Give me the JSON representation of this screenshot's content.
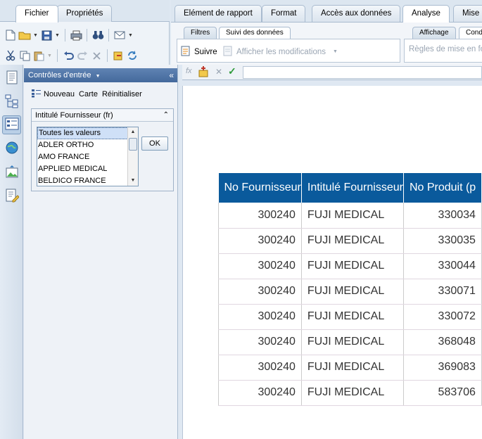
{
  "left_tabs": {
    "fichier": "Fichier",
    "proprietes": "Propriétés"
  },
  "ribbon": {
    "tabs": [
      "Elément de rapport",
      "Format",
      "Accès aux données",
      "Analyse",
      "Mise e"
    ],
    "active_tab": "Analyse",
    "subtabs_left": [
      "Filtres",
      "Suivi des données"
    ],
    "subtabs_right": [
      "Affichage",
      "Cond"
    ],
    "suivre_label": "Suivre",
    "afficher_label": "Afficher les modifications",
    "regles_label": "Règles de mise en fo"
  },
  "panel": {
    "title": "Contrôles d'entrée",
    "collapse_glyph": "«",
    "actions": {
      "nouveau": "Nouveau",
      "carte": "Carte",
      "reinitialiser": "Réinitialiser"
    },
    "control": {
      "title": "Intitulé Fournisseur (fr)",
      "items": [
        "Toutes les valeurs",
        "ADLER ORTHO",
        "AMO FRANCE",
        "APPLIED MEDICAL",
        "BELDICO FRANCE"
      ],
      "selected_index": 0,
      "ok_label": "OK"
    }
  },
  "formula_bar": {
    "fx": "fx",
    "value": ""
  },
  "report": {
    "columns": [
      "No Fournisseur",
      "Intitulé Fournisseur",
      "No Produit (p"
    ],
    "rows": [
      [
        "300240",
        "FUJI MEDICAL",
        "330034"
      ],
      [
        "300240",
        "FUJI MEDICAL",
        "330035"
      ],
      [
        "300240",
        "FUJI MEDICAL",
        "330044"
      ],
      [
        "300240",
        "FUJI MEDICAL",
        "330071"
      ],
      [
        "300240",
        "FUJI MEDICAL",
        "330072"
      ],
      [
        "300240",
        "FUJI MEDICAL",
        "368048"
      ],
      [
        "300240",
        "FUJI MEDICAL",
        "369083"
      ],
      [
        "300240",
        "FUJI MEDICAL",
        "583706"
      ]
    ]
  },
  "colors": {
    "header_bg": "#0a5a9c",
    "panel_head": "#44699c",
    "accent": "#dce6f0"
  }
}
